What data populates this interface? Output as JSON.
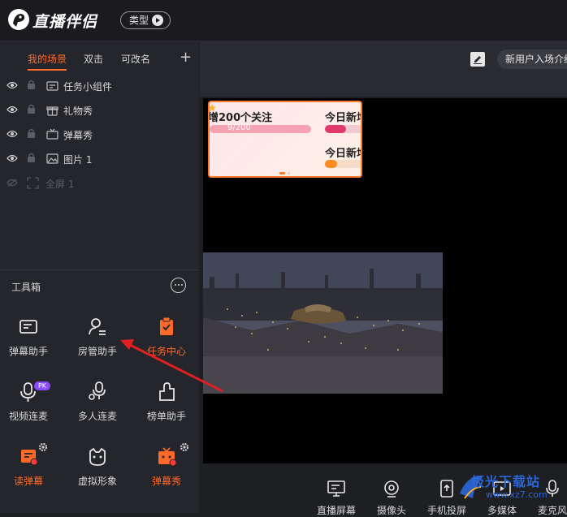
{
  "header": {
    "brand": "直播伴侣",
    "type_label": "类型"
  },
  "left": {
    "tabs": [
      {
        "label": "我的场景",
        "active": true
      },
      {
        "label": "双击",
        "active": false
      },
      {
        "label": "可改名",
        "active": false
      }
    ],
    "scenes": [
      {
        "label": "任务小组件",
        "icon": "widget-icon"
      },
      {
        "label": "礼物秀",
        "icon": "gift-icon"
      },
      {
        "label": "弹幕秀",
        "icon": "tv-icon"
      },
      {
        "label": "图片 1",
        "icon": "image-icon"
      },
      {
        "label": "全屏 1",
        "icon": "fullscreen-icon"
      }
    ],
    "toolbox_title": "工具箱",
    "tools": [
      {
        "label": "弹幕助手",
        "icon": "danmaku-assistant-icon"
      },
      {
        "label": "房管助手",
        "icon": "room-manager-icon"
      },
      {
        "label": "任务中心",
        "icon": "task-center-icon"
      },
      {
        "label": "视频连麦",
        "icon": "video-mic-icon",
        "badge": "PK"
      },
      {
        "label": "多人连麦",
        "icon": "multi-mic-icon"
      },
      {
        "label": "榜单助手",
        "icon": "ranking-icon"
      },
      {
        "label": "读弹幕",
        "icon": "read-danmaku-icon"
      },
      {
        "label": "虚拟形象",
        "icon": "avatar-icon"
      },
      {
        "label": "弹幕秀",
        "icon": "danmaku-show-icon"
      }
    ]
  },
  "stage": {
    "intro_button": "新用户入场介绍",
    "widget": {
      "title1": "增200个关注",
      "progress_text": "9/200",
      "progress": 0.045,
      "title2": "今日新增",
      "title3": "今日新增"
    }
  },
  "bottom": {
    "items": [
      {
        "label": "直播屏幕",
        "icon": "screen-icon"
      },
      {
        "label": "摄像头",
        "icon": "camera-icon"
      },
      {
        "label": "手机投屏",
        "icon": "phone-cast-icon"
      },
      {
        "label": "多媒体",
        "icon": "media-icon"
      },
      {
        "label": "麦克风",
        "icon": "mic-icon"
      }
    ]
  },
  "watermark": {
    "text": "极光下载站",
    "url": "www.xz7.com"
  },
  "colors": {
    "accent": "#ff6a2a",
    "background": "#1e1f23",
    "panel": "#25262b"
  }
}
